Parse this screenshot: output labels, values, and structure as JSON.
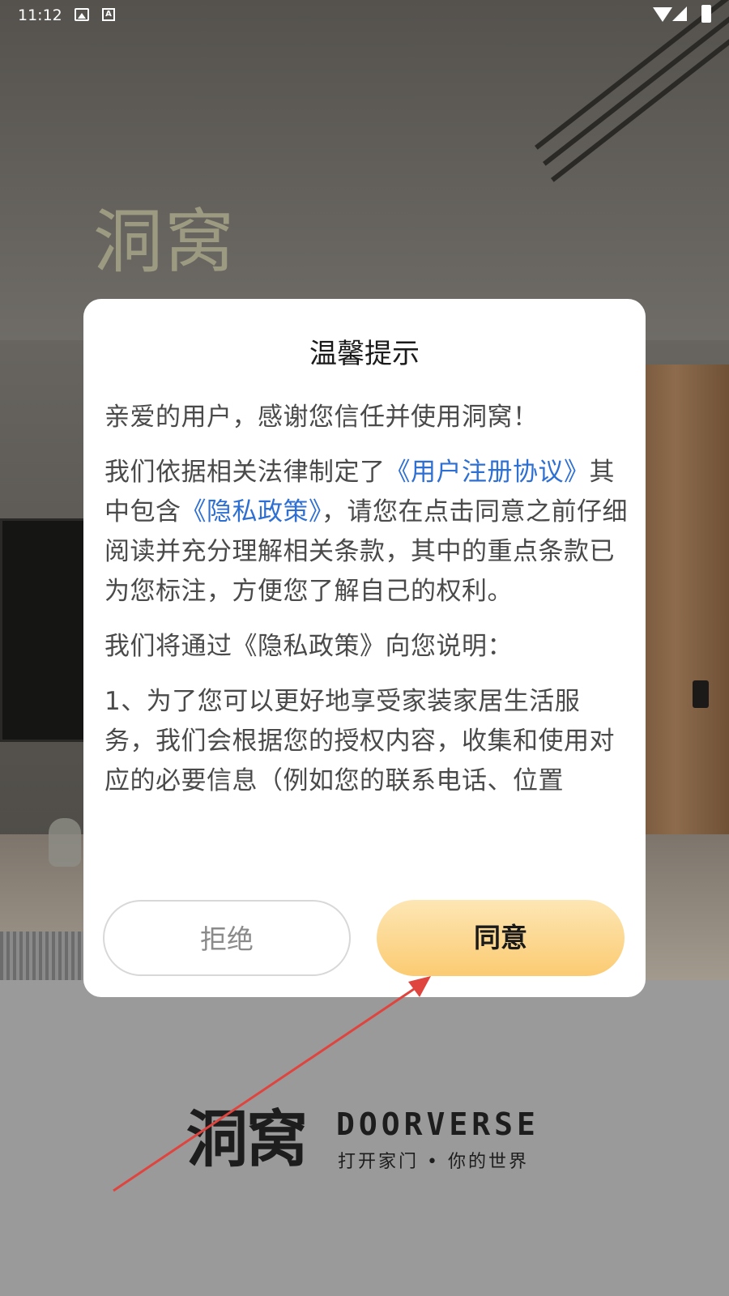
{
  "status_bar": {
    "time": "11:12",
    "icons": [
      "image-icon",
      "a-icon",
      "wifi-icon",
      "signal-icon",
      "battery-icon"
    ]
  },
  "background": {
    "hero_title": "洞窝"
  },
  "dialog": {
    "title": "温馨提示",
    "paragraphs": {
      "p1": "亲爱的用户，感谢您信任并使用洞窝！",
      "p2_a": "我们依据相关法律制定了",
      "p2_link1": "《用户注册协议》",
      "p2_b": "其中包含",
      "p2_link2": "《隐私政策》",
      "p2_c": "，请您在点击同意之前仔细阅读并充分理解相关条款，其中的重点条款已为您标注，方便您了解自己的权利。",
      "p3": "我们将通过《隐私政策》向您说明：",
      "p4": "1、为了您可以更好地享受家装家居生活服务，我们会根据您的授权内容，收集和使用对应的必要信息（例如您的联系电话、位置"
    },
    "reject_label": "拒绝",
    "agree_label": "同意"
  },
  "brand": {
    "name_cn": "洞窝",
    "name_en": "DOORVERSE",
    "slogan": "打开家门 • 你的世界"
  },
  "colors": {
    "link": "#2d6fd2",
    "agree_button_top": "#fde6b4",
    "agree_button_bottom": "#fbcb72",
    "annotation_arrow": "#e0443e"
  }
}
